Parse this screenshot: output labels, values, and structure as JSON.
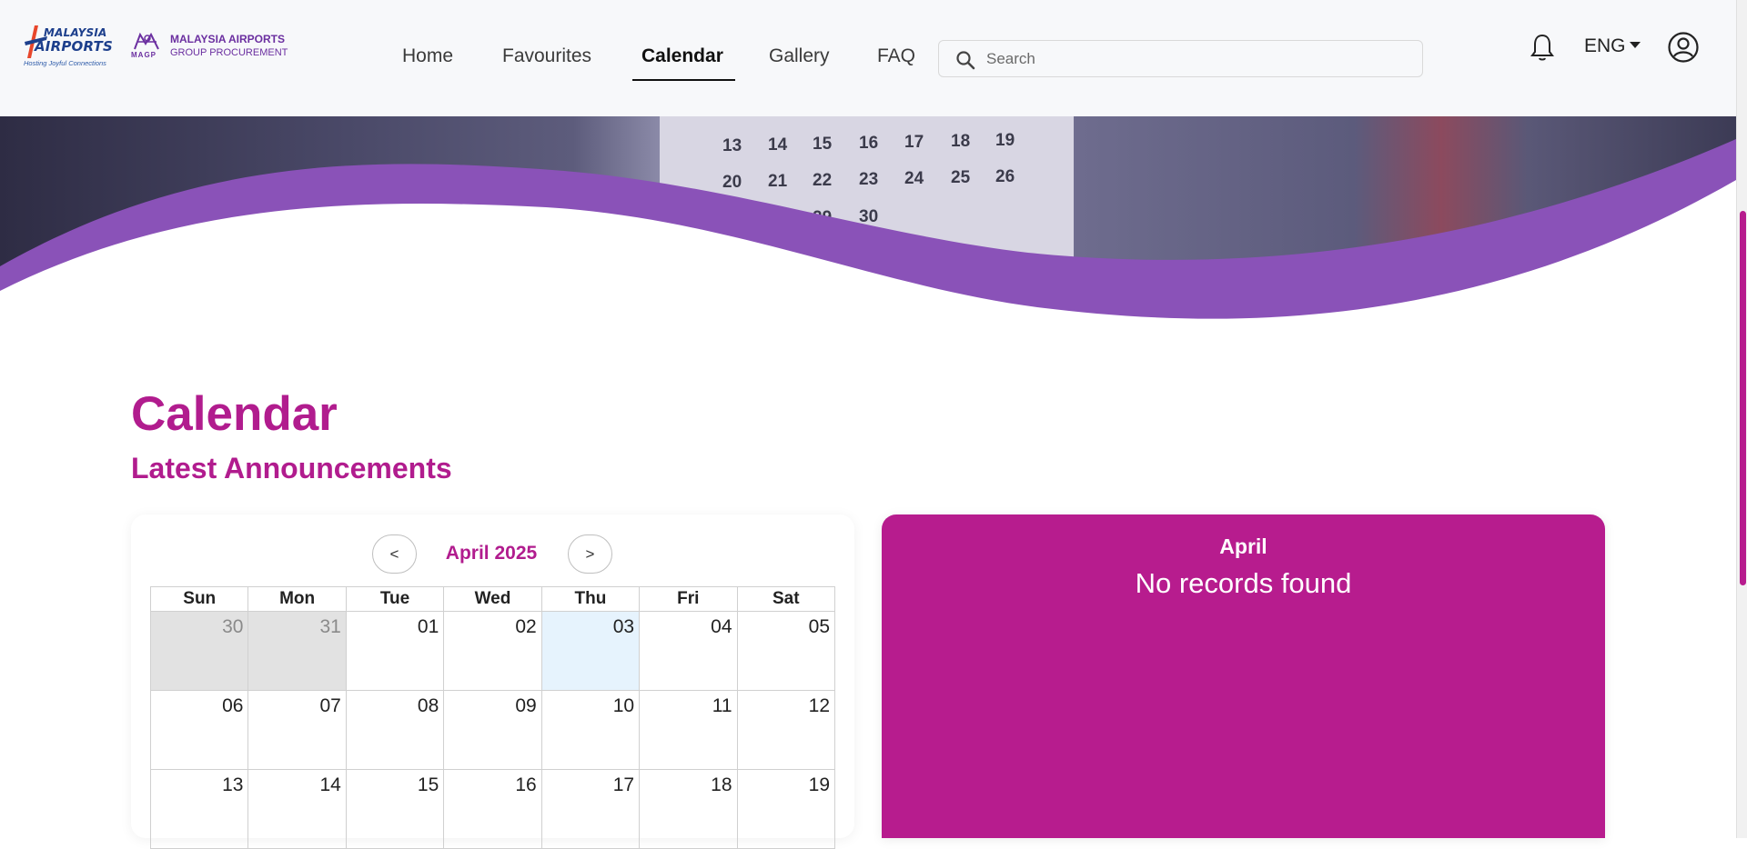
{
  "header": {
    "logo_primary": {
      "line1": "MALAYSIA",
      "line2": "AIRPORTS",
      "tagline": "Hosting Joyful Connections"
    },
    "logo_secondary": {
      "mark": "MAGP",
      "line1": "MALAYSIA AIRPORTS",
      "line2": "GROUP PROCUREMENT"
    },
    "nav": [
      {
        "label": "Home",
        "active": false
      },
      {
        "label": "Favourites",
        "active": false
      },
      {
        "label": "Calendar",
        "active": true
      },
      {
        "label": "Gallery",
        "active": false
      },
      {
        "label": "FAQ",
        "active": false
      }
    ],
    "search": {
      "placeholder": "Search",
      "value": ""
    },
    "language": "ENG",
    "icons": [
      "bell-icon",
      "user-account-icon",
      "search-icon"
    ]
  },
  "banner": {
    "calendar_numbers": [
      "13",
      "14",
      "15",
      "16",
      "17",
      "18",
      "19",
      "20",
      "21",
      "22",
      "23",
      "24",
      "25",
      "26",
      "29",
      "30"
    ]
  },
  "main": {
    "title": "Calendar",
    "subtitle": "Latest Announcements"
  },
  "calendar": {
    "month_label": "April 2025",
    "prev_label": "<",
    "next_label": ">",
    "weekdays": [
      "Sun",
      "Mon",
      "Tue",
      "Wed",
      "Thu",
      "Fri",
      "Sat"
    ],
    "weeks": [
      [
        "30",
        "31",
        "01",
        "02",
        "03",
        "04",
        "05"
      ],
      [
        "06",
        "07",
        "08",
        "09",
        "10",
        "11",
        "12"
      ],
      [
        "13",
        "14",
        "15",
        "16",
        "17",
        "18",
        "19"
      ]
    ],
    "highlighted_day": "03"
  },
  "announcements": {
    "month": "April",
    "empty_message": "No records found"
  },
  "colors": {
    "brand_magenta": "#b71c8e",
    "wave_purple": "#8a52b8",
    "today_cell": "#e6f3fd",
    "other_month_cell": "#e2e2e2"
  }
}
